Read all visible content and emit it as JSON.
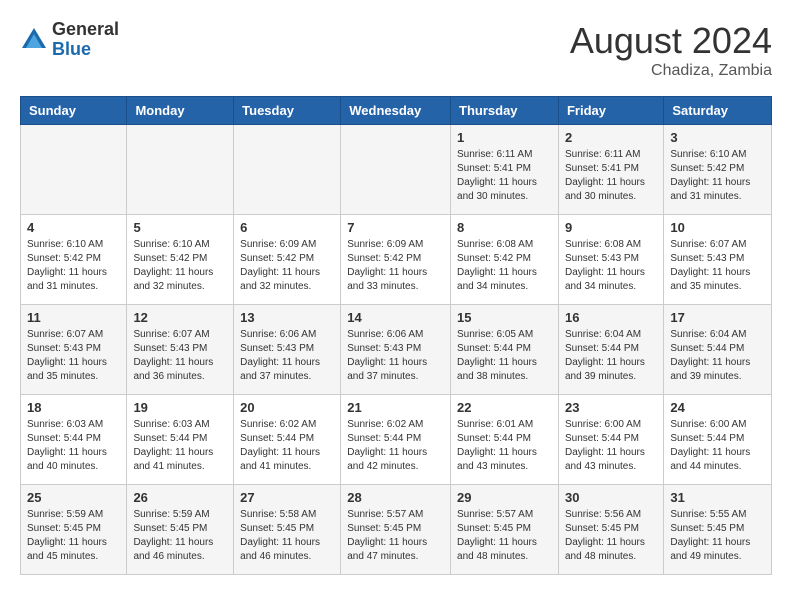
{
  "logo": {
    "general": "General",
    "blue": "Blue"
  },
  "title": "August 2024",
  "location": "Chadiza, Zambia",
  "days_header": [
    "Sunday",
    "Monday",
    "Tuesday",
    "Wednesday",
    "Thursday",
    "Friday",
    "Saturday"
  ],
  "weeks": [
    [
      {
        "day": "",
        "sunrise": "",
        "sunset": "",
        "daylight": ""
      },
      {
        "day": "",
        "sunrise": "",
        "sunset": "",
        "daylight": ""
      },
      {
        "day": "",
        "sunrise": "",
        "sunset": "",
        "daylight": ""
      },
      {
        "day": "",
        "sunrise": "",
        "sunset": "",
        "daylight": ""
      },
      {
        "day": "1",
        "sunrise": "Sunrise: 6:11 AM",
        "sunset": "Sunset: 5:41 PM",
        "daylight": "Daylight: 11 hours and 30 minutes."
      },
      {
        "day": "2",
        "sunrise": "Sunrise: 6:11 AM",
        "sunset": "Sunset: 5:41 PM",
        "daylight": "Daylight: 11 hours and 30 minutes."
      },
      {
        "day": "3",
        "sunrise": "Sunrise: 6:10 AM",
        "sunset": "Sunset: 5:42 PM",
        "daylight": "Daylight: 11 hours and 31 minutes."
      }
    ],
    [
      {
        "day": "4",
        "sunrise": "Sunrise: 6:10 AM",
        "sunset": "Sunset: 5:42 PM",
        "daylight": "Daylight: 11 hours and 31 minutes."
      },
      {
        "day": "5",
        "sunrise": "Sunrise: 6:10 AM",
        "sunset": "Sunset: 5:42 PM",
        "daylight": "Daylight: 11 hours and 32 minutes."
      },
      {
        "day": "6",
        "sunrise": "Sunrise: 6:09 AM",
        "sunset": "Sunset: 5:42 PM",
        "daylight": "Daylight: 11 hours and 32 minutes."
      },
      {
        "day": "7",
        "sunrise": "Sunrise: 6:09 AM",
        "sunset": "Sunset: 5:42 PM",
        "daylight": "Daylight: 11 hours and 33 minutes."
      },
      {
        "day": "8",
        "sunrise": "Sunrise: 6:08 AM",
        "sunset": "Sunset: 5:42 PM",
        "daylight": "Daylight: 11 hours and 34 minutes."
      },
      {
        "day": "9",
        "sunrise": "Sunrise: 6:08 AM",
        "sunset": "Sunset: 5:43 PM",
        "daylight": "Daylight: 11 hours and 34 minutes."
      },
      {
        "day": "10",
        "sunrise": "Sunrise: 6:07 AM",
        "sunset": "Sunset: 5:43 PM",
        "daylight": "Daylight: 11 hours and 35 minutes."
      }
    ],
    [
      {
        "day": "11",
        "sunrise": "Sunrise: 6:07 AM",
        "sunset": "Sunset: 5:43 PM",
        "daylight": "Daylight: 11 hours and 35 minutes."
      },
      {
        "day": "12",
        "sunrise": "Sunrise: 6:07 AM",
        "sunset": "Sunset: 5:43 PM",
        "daylight": "Daylight: 11 hours and 36 minutes."
      },
      {
        "day": "13",
        "sunrise": "Sunrise: 6:06 AM",
        "sunset": "Sunset: 5:43 PM",
        "daylight": "Daylight: 11 hours and 37 minutes."
      },
      {
        "day": "14",
        "sunrise": "Sunrise: 6:06 AM",
        "sunset": "Sunset: 5:43 PM",
        "daylight": "Daylight: 11 hours and 37 minutes."
      },
      {
        "day": "15",
        "sunrise": "Sunrise: 6:05 AM",
        "sunset": "Sunset: 5:44 PM",
        "daylight": "Daylight: 11 hours and 38 minutes."
      },
      {
        "day": "16",
        "sunrise": "Sunrise: 6:04 AM",
        "sunset": "Sunset: 5:44 PM",
        "daylight": "Daylight: 11 hours and 39 minutes."
      },
      {
        "day": "17",
        "sunrise": "Sunrise: 6:04 AM",
        "sunset": "Sunset: 5:44 PM",
        "daylight": "Daylight: 11 hours and 39 minutes."
      }
    ],
    [
      {
        "day": "18",
        "sunrise": "Sunrise: 6:03 AM",
        "sunset": "Sunset: 5:44 PM",
        "daylight": "Daylight: 11 hours and 40 minutes."
      },
      {
        "day": "19",
        "sunrise": "Sunrise: 6:03 AM",
        "sunset": "Sunset: 5:44 PM",
        "daylight": "Daylight: 11 hours and 41 minutes."
      },
      {
        "day": "20",
        "sunrise": "Sunrise: 6:02 AM",
        "sunset": "Sunset: 5:44 PM",
        "daylight": "Daylight: 11 hours and 41 minutes."
      },
      {
        "day": "21",
        "sunrise": "Sunrise: 6:02 AM",
        "sunset": "Sunset: 5:44 PM",
        "daylight": "Daylight: 11 hours and 42 minutes."
      },
      {
        "day": "22",
        "sunrise": "Sunrise: 6:01 AM",
        "sunset": "Sunset: 5:44 PM",
        "daylight": "Daylight: 11 hours and 43 minutes."
      },
      {
        "day": "23",
        "sunrise": "Sunrise: 6:00 AM",
        "sunset": "Sunset: 5:44 PM",
        "daylight": "Daylight: 11 hours and 43 minutes."
      },
      {
        "day": "24",
        "sunrise": "Sunrise: 6:00 AM",
        "sunset": "Sunset: 5:44 PM",
        "daylight": "Daylight: 11 hours and 44 minutes."
      }
    ],
    [
      {
        "day": "25",
        "sunrise": "Sunrise: 5:59 AM",
        "sunset": "Sunset: 5:45 PM",
        "daylight": "Daylight: 11 hours and 45 minutes."
      },
      {
        "day": "26",
        "sunrise": "Sunrise: 5:59 AM",
        "sunset": "Sunset: 5:45 PM",
        "daylight": "Daylight: 11 hours and 46 minutes."
      },
      {
        "day": "27",
        "sunrise": "Sunrise: 5:58 AM",
        "sunset": "Sunset: 5:45 PM",
        "daylight": "Daylight: 11 hours and 46 minutes."
      },
      {
        "day": "28",
        "sunrise": "Sunrise: 5:57 AM",
        "sunset": "Sunset: 5:45 PM",
        "daylight": "Daylight: 11 hours and 47 minutes."
      },
      {
        "day": "29",
        "sunrise": "Sunrise: 5:57 AM",
        "sunset": "Sunset: 5:45 PM",
        "daylight": "Daylight: 11 hours and 48 minutes."
      },
      {
        "day": "30",
        "sunrise": "Sunrise: 5:56 AM",
        "sunset": "Sunset: 5:45 PM",
        "daylight": "Daylight: 11 hours and 48 minutes."
      },
      {
        "day": "31",
        "sunrise": "Sunrise: 5:55 AM",
        "sunset": "Sunset: 5:45 PM",
        "daylight": "Daylight: 11 hours and 49 minutes."
      }
    ]
  ]
}
